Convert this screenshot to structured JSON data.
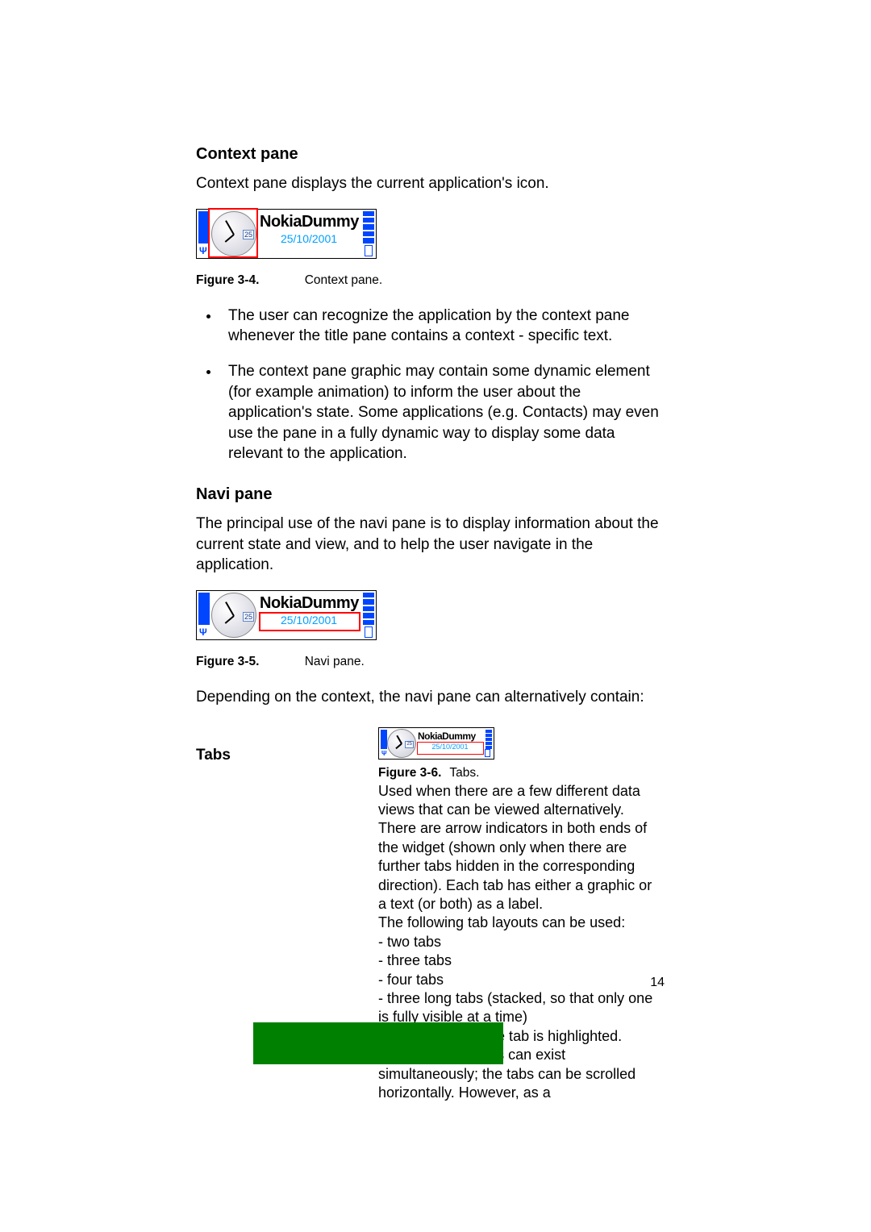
{
  "sections": {
    "context": {
      "title": "Context pane",
      "intro": "Context pane displays the current application's icon.",
      "figure": {
        "num": "Figure 3-4.",
        "caption": "Context pane."
      },
      "bullets": [
        "The user can recognize the application by the context pane whenever the title pane contains a context - specific text.",
        "The context pane graphic may contain some dynamic element (for example animation) to inform the user about the application's state. Some applications (e.g. Contacts) may even use the pane in a fully dynamic way to display some data relevant to the application."
      ]
    },
    "navi": {
      "title": "Navi pane",
      "intro": "The principal use of the navi pane is to display information about the current state and view, and to help the user navigate in the application.",
      "figure": {
        "num": "Figure 3-5.",
        "caption": "Navi pane."
      },
      "after": "Depending on the context, the navi pane can alternatively contain:"
    },
    "tabs": {
      "label": "Tabs",
      "figure": {
        "num": "Figure 3-6.",
        "caption": "Tabs."
      },
      "body": "Used when there are a few different data views that can be viewed alternatively. There are arrow indicators in both ends of the widget (shown only when there are further tabs hidden in the corresponding direction). Each tab has either a graphic or a text (or both) as a label.\nThe following tab layouts can be used:\n- two tabs\n- three tabs\n- four tabs\n- three long tabs (stacked, so that only one is fully visible at a time)\nThe currently active tab is highlighted.\nMore than four tabs can exist simultaneously; the tabs can be scrolled horizontally. However, as a"
    }
  },
  "statusbar": {
    "title": "NokiaDummy",
    "date": "25/10/2001",
    "clock_badge": "25"
  },
  "page_number": "14"
}
